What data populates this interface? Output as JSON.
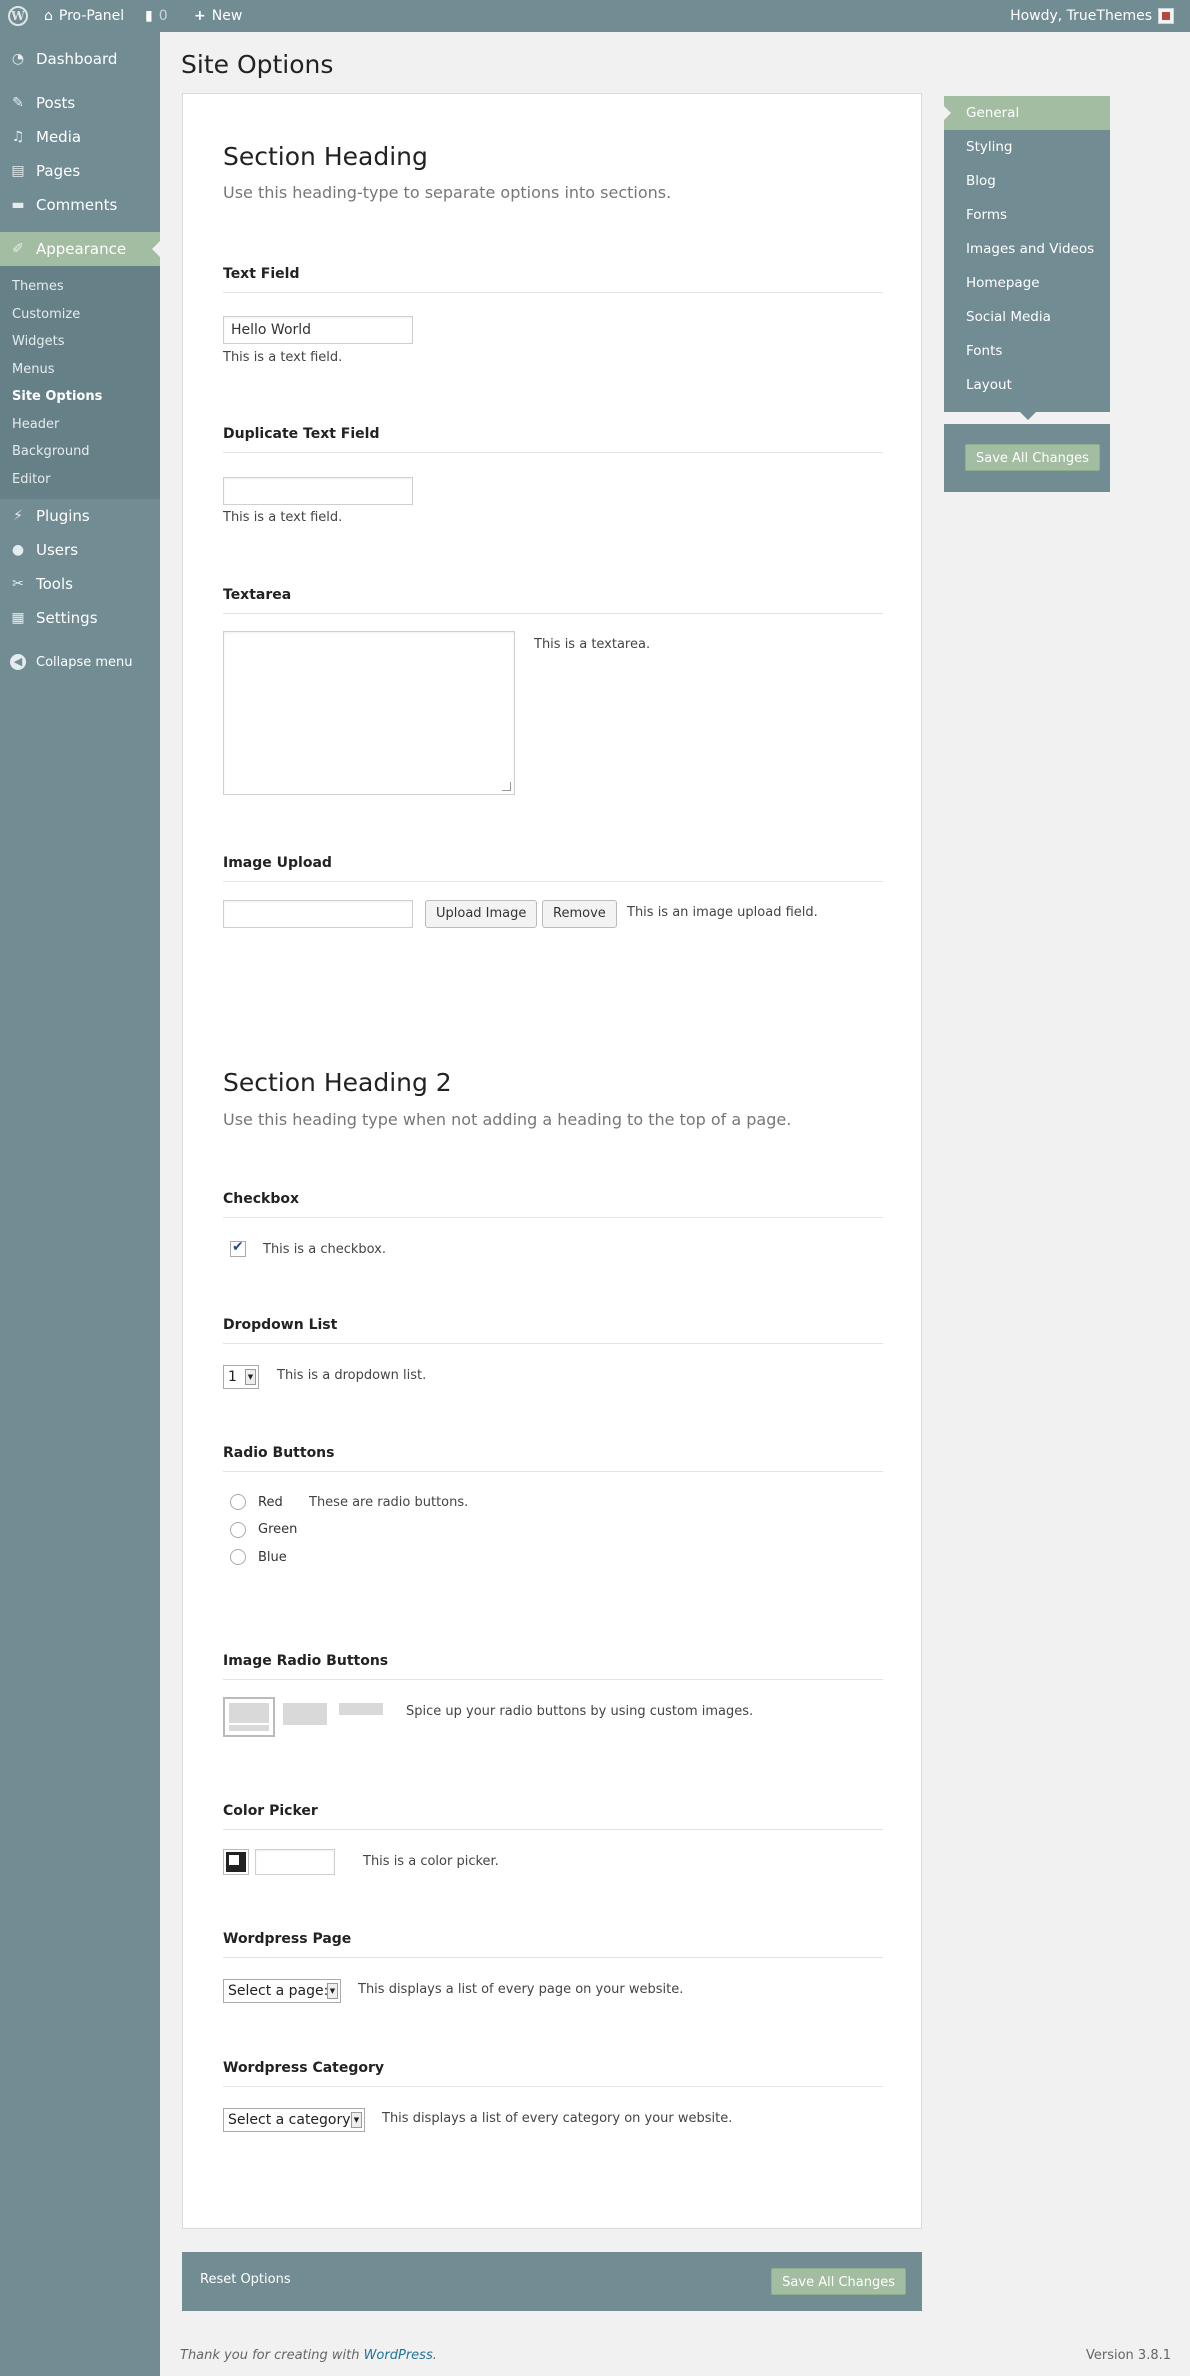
{
  "adminbar": {
    "site_name": "Pro-Panel",
    "comments_count": "0",
    "new_label": "New",
    "howdy": "Howdy, TrueThemes"
  },
  "sidebar": {
    "items": [
      {
        "label": "Dashboard",
        "icon": "dashboard-icon"
      },
      {
        "label": "Posts",
        "icon": "pin-icon"
      },
      {
        "label": "Media",
        "icon": "media-icon"
      },
      {
        "label": "Pages",
        "icon": "pages-icon"
      },
      {
        "label": "Comments",
        "icon": "comment-icon"
      },
      {
        "label": "Appearance",
        "icon": "brush-icon"
      },
      {
        "label": "Plugins",
        "icon": "plug-icon"
      },
      {
        "label": "Users",
        "icon": "user-icon"
      },
      {
        "label": "Tools",
        "icon": "wrench-icon"
      },
      {
        "label": "Settings",
        "icon": "settings-icon"
      }
    ],
    "submenu": [
      "Themes",
      "Customize",
      "Widgets",
      "Menus",
      "Site Options",
      "Header",
      "Background",
      "Editor"
    ],
    "collapse": "Collapse menu"
  },
  "page": {
    "title": "Site Options"
  },
  "main": {
    "section1": {
      "heading": "Section Heading",
      "desc": "Use this heading-type to separate options into sections."
    },
    "text_field": {
      "label": "Text Field",
      "value": "Hello World",
      "help": "This is a text field."
    },
    "dup_text_field": {
      "label": "Duplicate Text Field",
      "value": "",
      "help": "This is a text field."
    },
    "textarea": {
      "label": "Textarea",
      "help": "This is a textarea."
    },
    "image_upload": {
      "label": "Image Upload",
      "upload_btn": "Upload Image",
      "remove_btn": "Remove",
      "help": "This is an image upload field."
    },
    "section2": {
      "heading": "Section Heading 2",
      "desc": "Use this heading type when not adding a heading to the top of a page."
    },
    "checkbox": {
      "label": "Checkbox",
      "help": "This is a checkbox."
    },
    "dropdown": {
      "label": "Dropdown List",
      "value": "1",
      "help": "This is a dropdown list."
    },
    "radio": {
      "label": "Radio Buttons",
      "options": [
        "Red",
        "Green",
        "Blue"
      ],
      "help": "These are radio buttons."
    },
    "image_radio": {
      "label": "Image Radio Buttons",
      "help": "Spice up your radio buttons by using custom images."
    },
    "color_picker": {
      "label": "Color Picker",
      "help": "This is a color picker."
    },
    "wp_page": {
      "label": "Wordpress Page",
      "value": "Select a page:",
      "help": "This displays a list of every page on your website."
    },
    "wp_category": {
      "label": "Wordpress Category",
      "value": "Select a category:",
      "help": "This displays a list of every category on your website."
    }
  },
  "optnav": {
    "items": [
      "General",
      "Styling",
      "Blog",
      "Forms",
      "Images and Videos",
      "Homepage",
      "Social Media",
      "Fonts",
      "Layout"
    ],
    "save": "Save All Changes"
  },
  "bottombar": {
    "reset": "Reset Options",
    "save": "Save All Changes"
  },
  "footer": {
    "thanks_prefix": "Thank you for creating with ",
    "thanks_link": "WordPress",
    "thanks_suffix": ".",
    "version": "Version 3.8.1"
  },
  "colors": {
    "sidebar": "#728c94",
    "accent": "#a3bda2",
    "submenu": "#668087"
  }
}
